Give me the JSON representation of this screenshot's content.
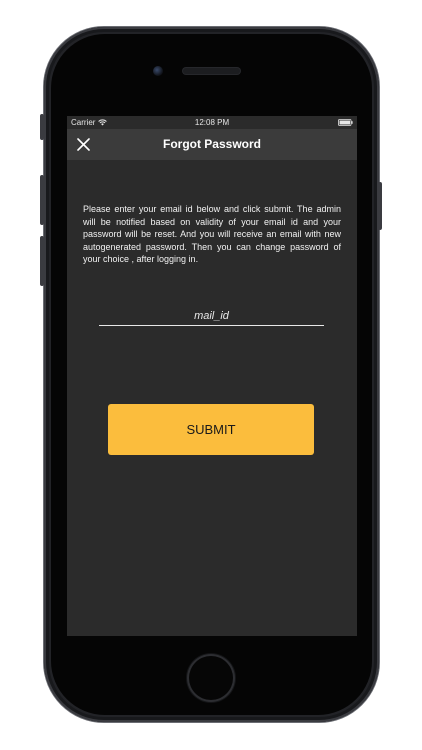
{
  "status_bar": {
    "carrier": "Carrier",
    "time": "12:08 PM",
    "wifi_icon": "wifi-icon",
    "battery_icon": "battery-icon"
  },
  "nav": {
    "title": "Forgot Password",
    "close_icon": "close-icon"
  },
  "form": {
    "description": "Please enter your email id below and click submit. The admin will be notified based on validity of your email id and your password will be reset. And you will receive an email with new autogenerated password. Then you can change password of your choice , after logging in.",
    "email_placeholder": "mail_id",
    "email_value": "",
    "submit_label": "SUBMIT"
  },
  "colors": {
    "background": "#2b2b2b",
    "nav_bar": "#3b3b3b",
    "accent": "#fbbd3d",
    "text": "#f2f2f2"
  }
}
